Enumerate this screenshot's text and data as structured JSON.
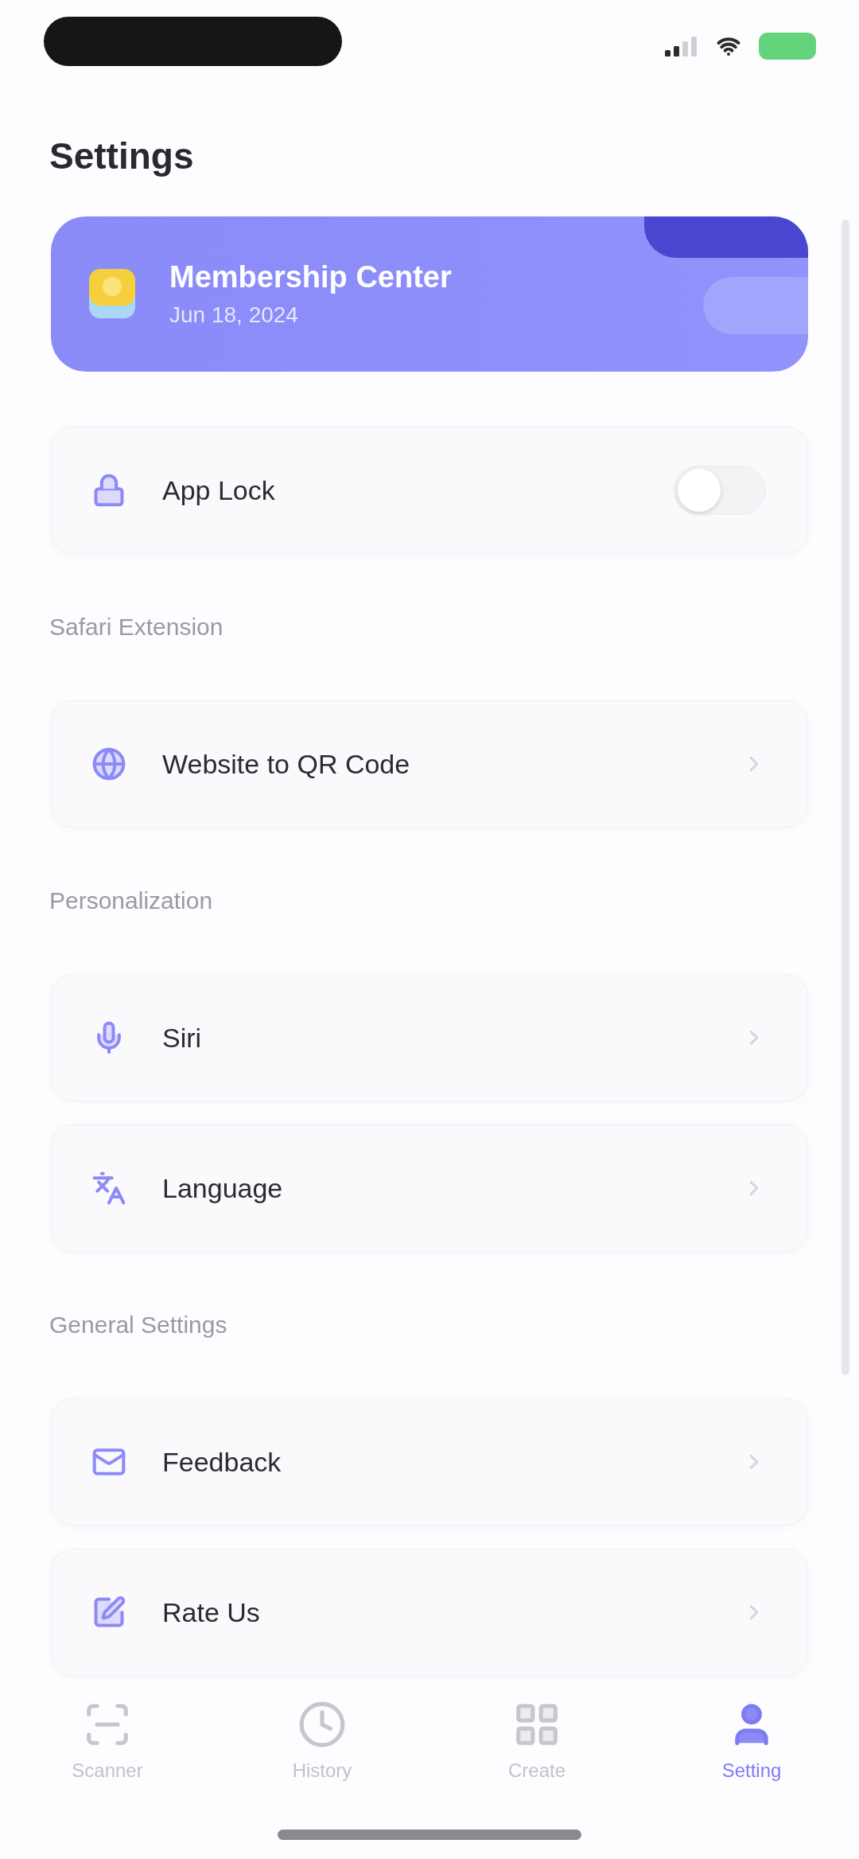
{
  "page": {
    "title": "Settings"
  },
  "membership_card": {
    "title": "Membership Center",
    "subtitle": "Jun 18, 2024"
  },
  "sections": [
    {
      "items": [
        {
          "kind": "toggle",
          "label": "App Lock",
          "on": false
        }
      ]
    },
    {
      "heading": "Safari Extension",
      "items": [
        {
          "kind": "link",
          "label": "Website to QR Code"
        }
      ]
    },
    {
      "heading": "Personalization",
      "items": [
        {
          "kind": "link",
          "label": "Siri"
        },
        {
          "kind": "link",
          "label": "Language"
        }
      ]
    },
    {
      "heading": "General Settings",
      "items": [
        {
          "kind": "link",
          "label": "Feedback"
        },
        {
          "kind": "link",
          "label": "Rate Us"
        }
      ]
    }
  ],
  "tab_bar": [
    {
      "label": "Scanner",
      "selected": false
    },
    {
      "label": "History",
      "selected": false
    },
    {
      "label": "Create",
      "selected": false
    },
    {
      "label": "Setting",
      "selected": true
    }
  ]
}
